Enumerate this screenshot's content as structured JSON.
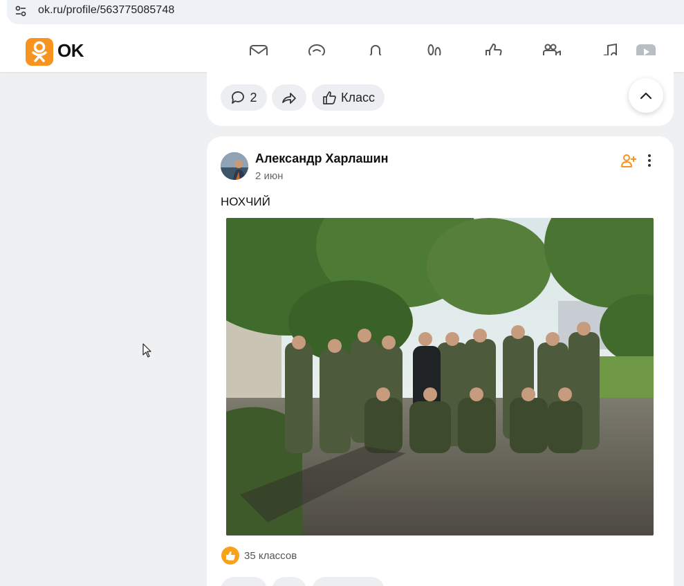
{
  "browser": {
    "url": "ok.ru/profile/563775085748",
    "site_info_icon": "tune-icon"
  },
  "header": {
    "logo_text": "OK",
    "brand_color": "#f7931e",
    "nav_icons": [
      "mail-icon",
      "chat-icon",
      "bell-icon",
      "footprints-icon",
      "thumbs-up-icon",
      "video-camera-icon",
      "music-icon",
      "video-play-icon"
    ]
  },
  "prev_post": {
    "comments_count": "2",
    "share_icon": "share-icon",
    "like_label": "Класс"
  },
  "post": {
    "author": "Александр Харлашин",
    "date": "2 июн",
    "text": "НОХЧИЙ",
    "likes_text": "35 классов",
    "add_friend_icon": "add-friend-icon",
    "menu_icon": "more-vertical-icon"
  },
  "accent_color": "#f7931e"
}
